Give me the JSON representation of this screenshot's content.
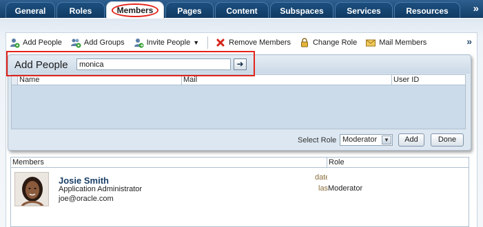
{
  "tabs": [
    {
      "label": "General"
    },
    {
      "label": "Roles"
    },
    {
      "label": "Members"
    },
    {
      "label": "Pages"
    },
    {
      "label": "Content"
    },
    {
      "label": "Subspaces"
    },
    {
      "label": "Services"
    },
    {
      "label": "Resources"
    }
  ],
  "active_tab": "Members",
  "tab_more": "»",
  "toolbar": {
    "add_people": "Add People",
    "add_groups": "Add Groups",
    "invite_people": "Invite People",
    "remove_members": "Remove Members",
    "change_role": "Change Role",
    "mail_members": "Mail Members",
    "more": "»"
  },
  "add_panel": {
    "title": "Add People",
    "search_value": "monica",
    "go_arrow": "➜",
    "columns": [
      "Name",
      "Mail",
      "User ID"
    ],
    "select_role_label": "Select Role",
    "selected_role": "Moderator",
    "add_button": "Add",
    "done_button": "Done"
  },
  "members": {
    "columns": [
      "Members",
      "Role"
    ],
    "rows": [
      {
        "name": "Josie Smith",
        "title": "Application Administrator",
        "email": "joe@oracle.com",
        "date_fragment": "date",
        "last_fragment": "las",
        "role": "Moderator"
      }
    ]
  },
  "colors": {
    "tab_bar": "#15406b",
    "highlight": "#e2231a",
    "panel_bg": "#dde7f1",
    "name_link": "#183e66"
  }
}
